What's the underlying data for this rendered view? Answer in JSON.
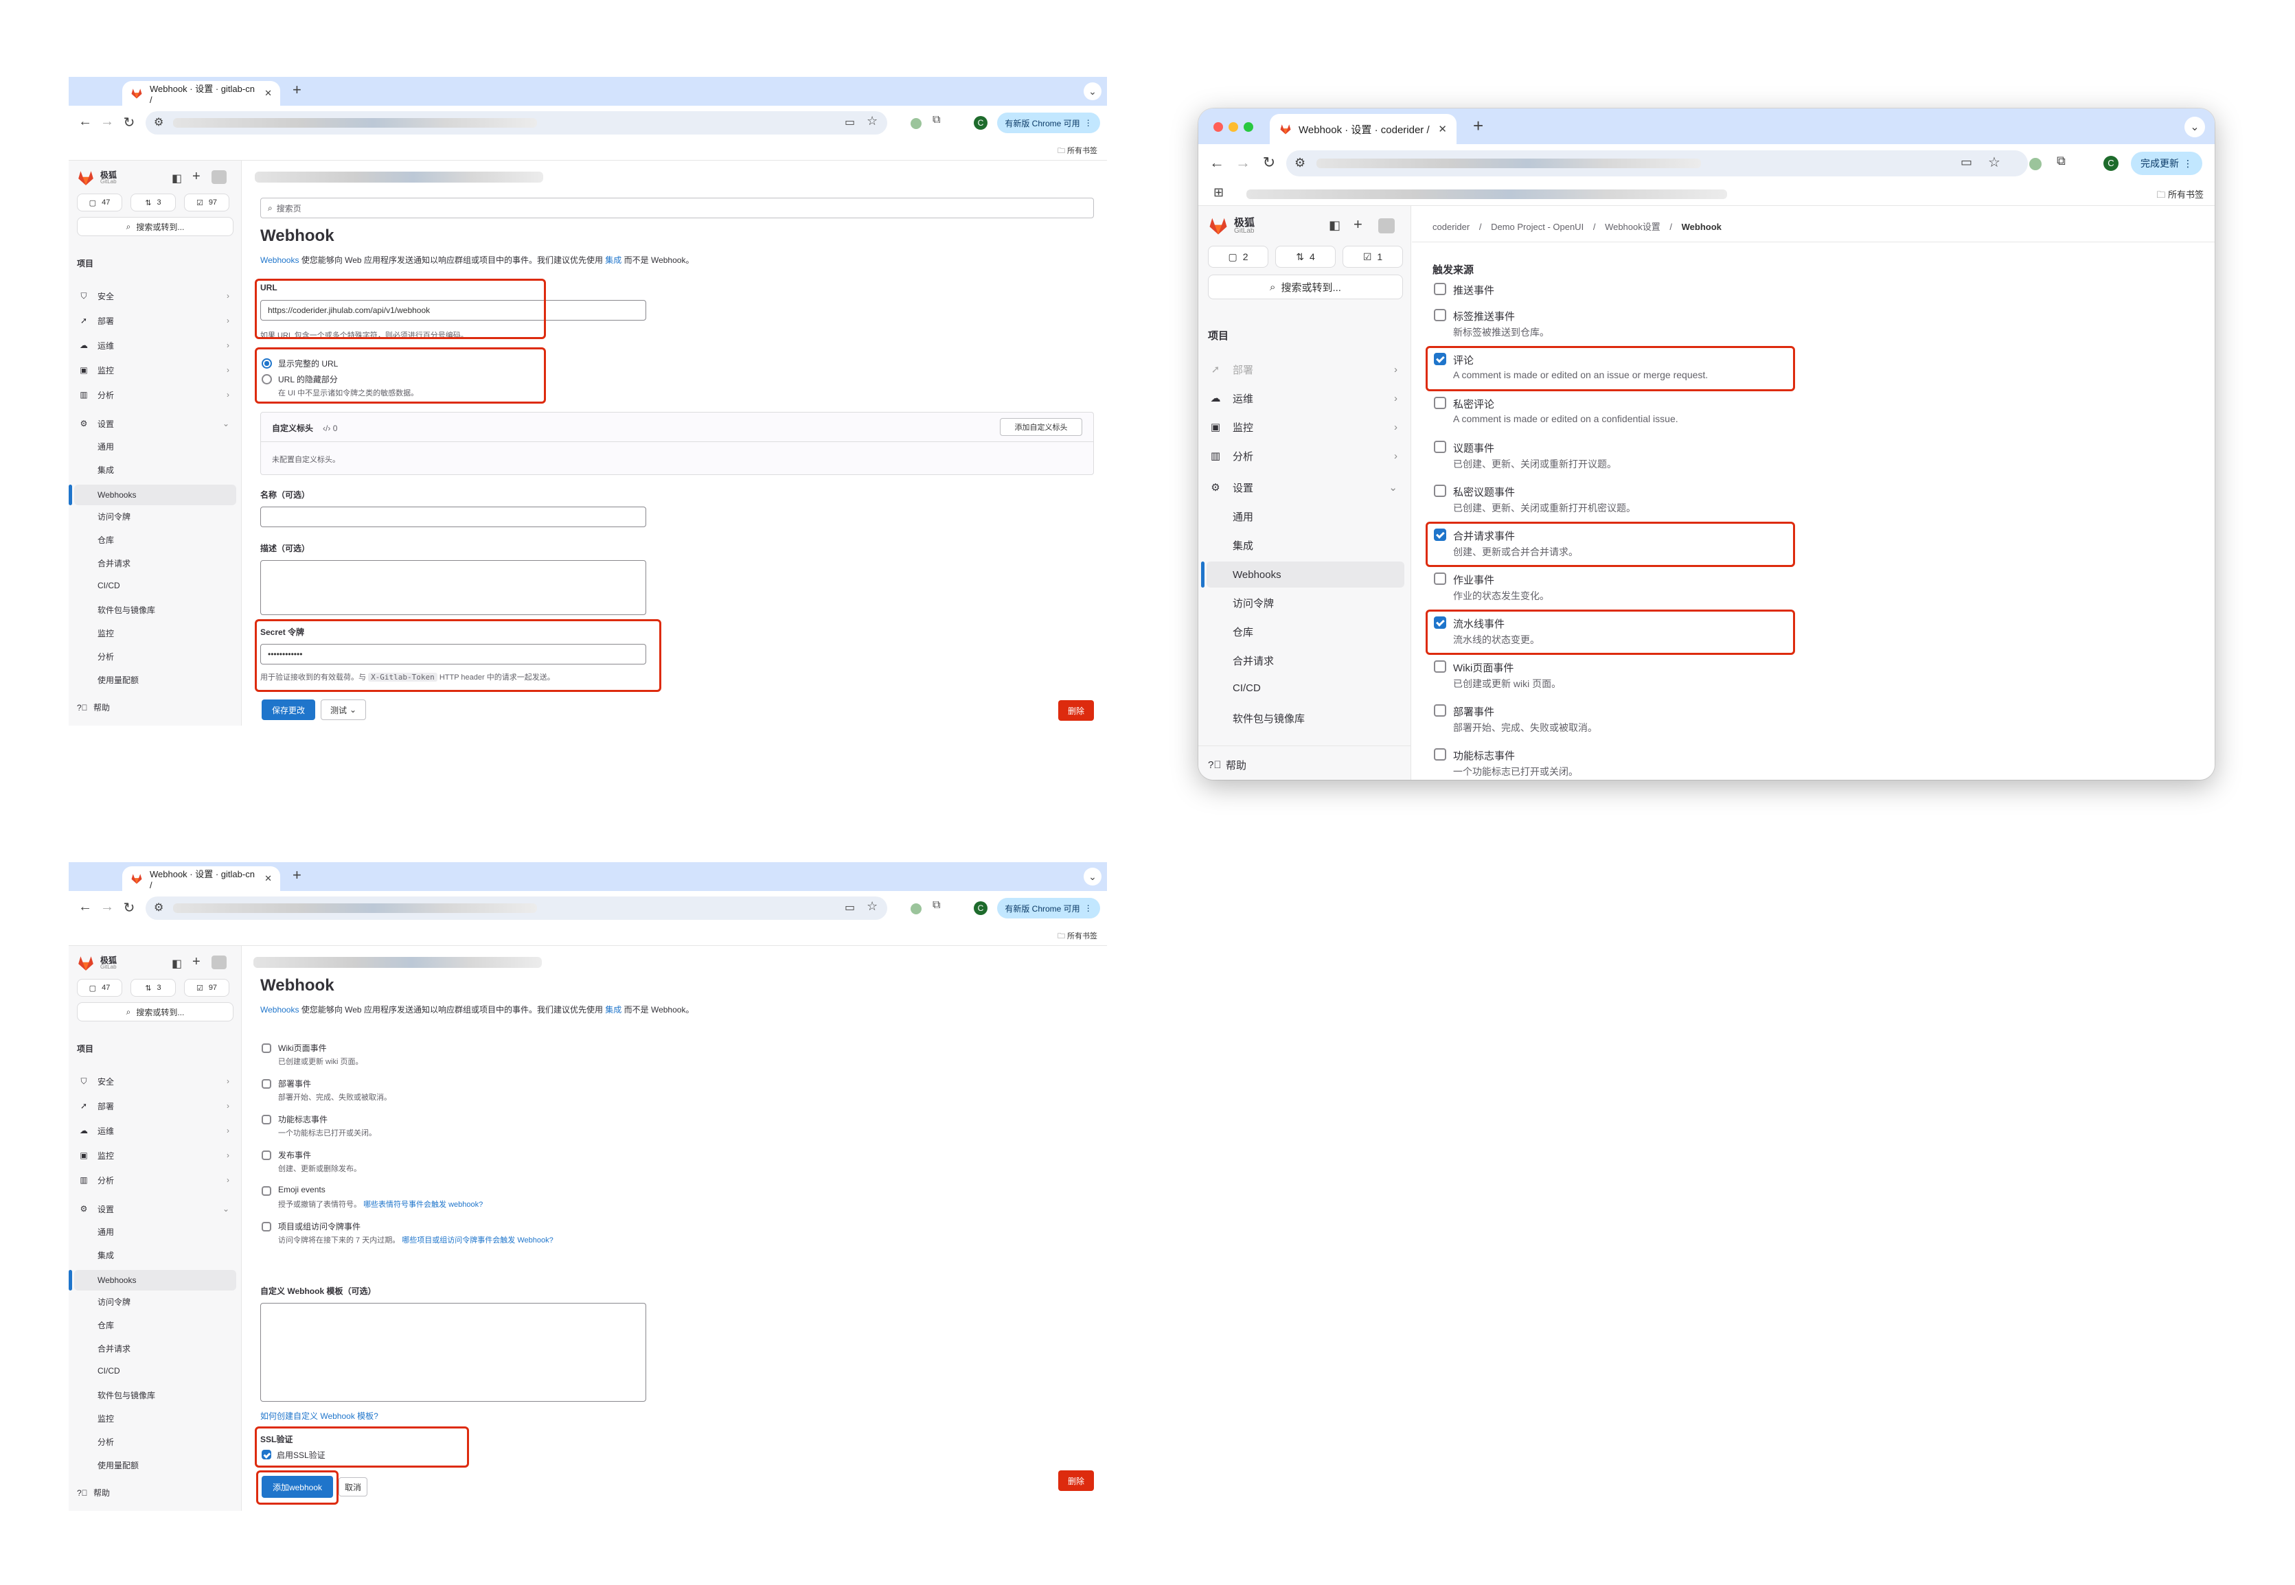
{
  "browser": {
    "tab_title_a": "Webhook · 设置 · gitlab-cn /",
    "tab_title_b": "Webhook · 设置 · coderider /",
    "new_tab": "+",
    "close": "✕",
    "update_pill_a": "有新版 Chrome 可用",
    "update_pill_b": "完成更新",
    "profile_initial": "C",
    "bookmarks_label": "所有书签"
  },
  "sidebar": {
    "logo_text": "极狐",
    "logo_sub": "GitLab",
    "counts_a": {
      "issues": "47",
      "mrs": "3",
      "todos": "97"
    },
    "counts_b": {
      "issues": "2",
      "mrs": "4",
      "todos": "1"
    },
    "search_label": "搜索或转到...",
    "section_project": "项目",
    "item_security": "安全",
    "item_deploy": "部署",
    "item_operate": "运维",
    "item_monitor": "监控",
    "item_analytics": "分析",
    "item_settings": "设置",
    "sub_general": "通用",
    "sub_integrations": "集成",
    "sub_webhooks": "Webhooks",
    "sub_access_tokens": "访问令牌",
    "sub_repository": "仓库",
    "sub_merge_requests": "合并请求",
    "sub_cicd": "CI/CD",
    "sub_packages": "软件包与镜像库",
    "sub_monitor": "监控",
    "sub_analytics": "分析",
    "sub_usage": "使用量配额",
    "help": "帮助"
  },
  "breadcrumb": {
    "b1": "coderider",
    "b2": "Demo Project - OpenUI",
    "b3": "Webhook设置",
    "b4": "Webhook",
    "sep": "/"
  },
  "form": {
    "search_placeholder": "搜索页",
    "page_title": "Webhook",
    "intro_link": "Webhooks",
    "intro_text": " 使您能够向 Web 应用程序发送通知以响应群组或项目中的事件。我们建议优先使用 ",
    "intro_link2": "集成",
    "intro_tail": " 而不是 Webhook。",
    "url_label": "URL",
    "url_value": "https://coderider.jihulab.com/api/v1/webhook",
    "url_help": "如果 URL 包含一个或多个特殊字符，则必须进行百分号编码。",
    "radio_full": "显示完整的 URL",
    "radio_masked": "URL 的隐藏部分",
    "radio_masked_help": "在 UI 中不显示诸如令牌之类的敏感数据。",
    "custom_headers": "自定义标头",
    "custom_headers_count": "0",
    "add_header_btn": "添加自定义标头",
    "no_headers": "未配置自定义标头。",
    "name_label": "名称（可选）",
    "desc_label": "描述（可选）",
    "secret_label": "Secret 令牌",
    "secret_value": "••••••••••••",
    "secret_help_a": "用于验证接收到的有效载荷。与 ",
    "secret_help_code": "X-Gitlab-Token",
    "secret_help_b": " HTTP header 中的请求一起发送。",
    "save_btn": "保存更改",
    "test_btn": "测试",
    "delete_btn": "删除"
  },
  "triggers": {
    "heading": "触发来源",
    "push": "推送事件",
    "tag_push": "标签推送事件",
    "tag_push_desc": "新标签被推送到仓库。",
    "comments": "评论",
    "comments_desc": "A comment is made or edited on an issue or merge request.",
    "confidential_comments": "私密评论",
    "confidential_comments_desc": "A comment is made or edited on a confidential issue.",
    "issues": "议题事件",
    "issues_desc": "已创建、更新、关闭或重新打开议题。",
    "confidential_issues": "私密议题事件",
    "confidential_issues_desc": "已创建、更新、关闭或重新打开机密议题。",
    "merge_requests": "合并请求事件",
    "merge_requests_desc": "创建、更新或合并合并请求。",
    "jobs": "作业事件",
    "jobs_desc": "作业的状态发生变化。",
    "pipelines": "流水线事件",
    "pipelines_desc": "流水线的状态变更。",
    "wiki": "Wiki页面事件",
    "wiki_desc": "已创建或更新 wiki 页面。",
    "deployments": "部署事件",
    "deployments_desc": "部署开始、完成、失败或被取消。",
    "feature_flags": "功能标志事件",
    "feature_flags_desc": "一个功能标志已打开或关闭。",
    "releases": "发布事件",
    "releases_desc": "创建、更新或删除发布。",
    "emoji": "Emoji events",
    "emoji_desc": "授予或撤销了表情符号。",
    "emoji_link": "哪些表情符号事件会触发 webhook?",
    "access_tokens": "项目或组访问令牌事件",
    "access_tokens_desc": "访问令牌将在接下来的 7 天内过期。",
    "access_tokens_link": "哪些项目或组访问令牌事件会触发 Webhook?"
  },
  "template": {
    "label": "自定义 Webhook 模板（可选）",
    "help_link": "如何创建自定义 Webhook 模板?",
    "ssl_label": "SSL验证",
    "ssl_checkbox": "启用SSL验证",
    "add_btn": "添加webhook",
    "cancel_btn": "取消",
    "delete_btn": "删除"
  }
}
